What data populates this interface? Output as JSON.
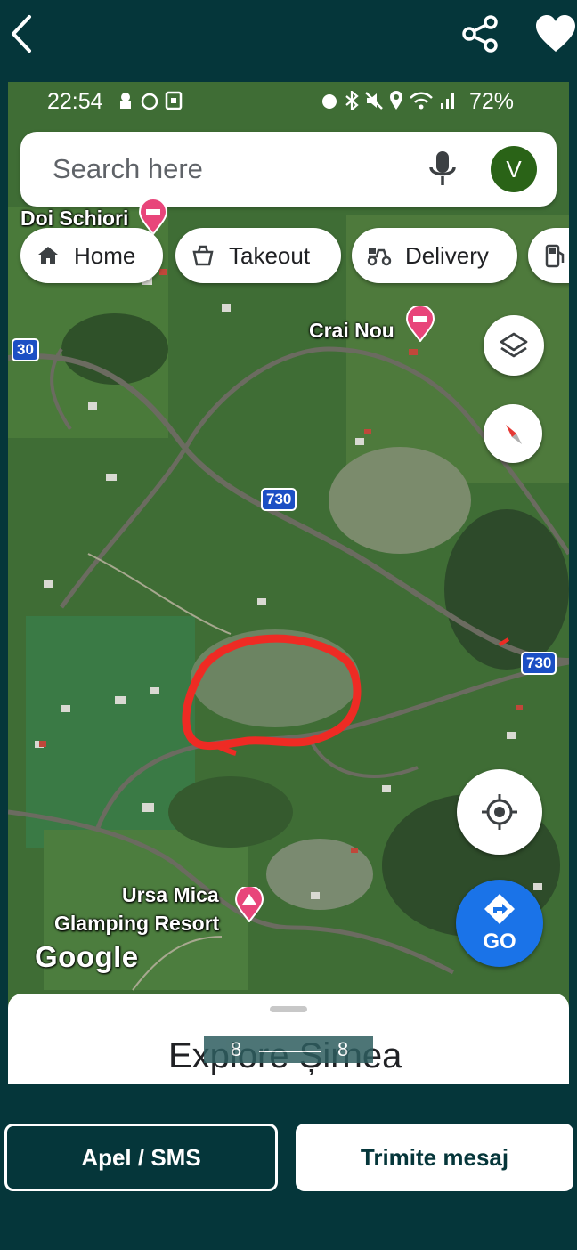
{
  "header": {
    "back_icon": "chevron-left-icon",
    "share_icon": "share-icon",
    "favorite_icon": "heart-icon"
  },
  "status_bar": {
    "time": "22:54",
    "battery": "72%"
  },
  "maps": {
    "search": {
      "placeholder": "Search here",
      "avatar_letter": "V"
    },
    "chips": [
      {
        "label": "Home",
        "icon": "home-icon"
      },
      {
        "label": "Takeout",
        "icon": "takeout-icon"
      },
      {
        "label": "Delivery",
        "icon": "delivery-icon"
      },
      {
        "label": "",
        "icon": "gas-station-icon"
      }
    ],
    "places": {
      "doi_schiori": "Doi Schiori",
      "crai_nou": "Crai Nou",
      "ursa_mica_line1": "Ursa Mica",
      "ursa_mica_line2": "Glamping Resort"
    },
    "road_shields": {
      "left": "30",
      "mid": "730",
      "right": "730"
    },
    "google_logo": "Google",
    "go_label": "GO",
    "sheet": {
      "title": "Explore Șirnea",
      "overlay_left": "8",
      "overlay_right": "8"
    }
  },
  "actions": {
    "call_label": "Apel / SMS",
    "message_label": "Trimite mesaj"
  },
  "colors": {
    "app_background": "#05363a",
    "go_button": "#1a73e8",
    "pin_pink": "#e8457a",
    "highlight_red": "#ee2b24"
  }
}
